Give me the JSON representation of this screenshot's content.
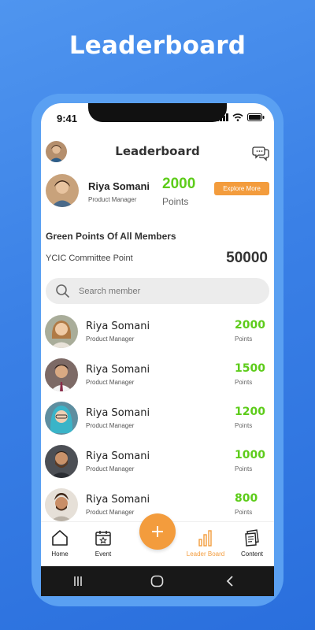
{
  "promo_title": "Leaderboard",
  "status_bar": {
    "time": "9:41"
  },
  "header": {
    "title": "Leaderboard"
  },
  "me": {
    "name": "Riya Somani",
    "role": "Product Manager",
    "points": "2000",
    "points_label": "Points",
    "explore_label": "Explore More"
  },
  "section_title": "Green Points Of All Members",
  "committee": {
    "label": "YCIC Committee Point",
    "value": "50000"
  },
  "search": {
    "placeholder": "Search member"
  },
  "members": [
    {
      "name": "Riya Somani",
      "role": "Product Manager",
      "points": "2000",
      "points_label": "Points"
    },
    {
      "name": "Riya Somani",
      "role": "Product Manager",
      "points": "1500",
      "points_label": "Points"
    },
    {
      "name": "Riya Somani",
      "role": "Product Manager",
      "points": "1200",
      "points_label": "Points"
    },
    {
      "name": "Riya Somani",
      "role": "Product Manager",
      "points": "1000",
      "points_label": "Points"
    },
    {
      "name": "Riya Somani",
      "role": "Product Manager",
      "points": "800",
      "points_label": "Points"
    }
  ],
  "nav": {
    "home": "Home",
    "event": "Event",
    "leaderboard": "Leader Board",
    "content": "Content",
    "active": "leaderboard"
  },
  "colors": {
    "accent_orange": "#f39c3d",
    "points_green": "#5dcc1a",
    "background_blue": "#3a80e6"
  }
}
